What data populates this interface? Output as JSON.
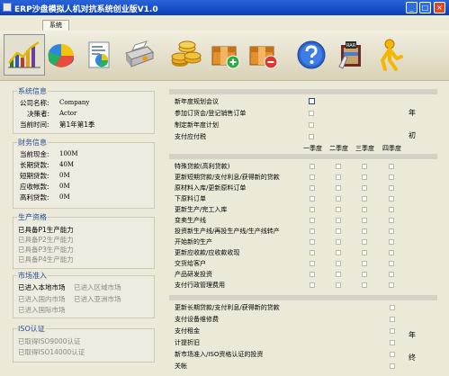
{
  "window": {
    "title": "ERP沙盘模拟人机对抗系统创业版V1.0",
    "controls": {
      "min": "_",
      "max": "□",
      "close": "×"
    }
  },
  "tabs": [
    {
      "label": "系统"
    }
  ],
  "toolbar": {
    "buttons": [
      {
        "icon": "line-chart-icon"
      },
      {
        "icon": "pie-chart-icon"
      },
      {
        "icon": "report-document-icon"
      },
      {
        "icon": "printer-icon"
      },
      {
        "icon": "coins-icon"
      },
      {
        "icon": "add-box-icon"
      },
      {
        "icon": "remove-box-icon"
      },
      {
        "icon": "help-icon"
      },
      {
        "icon": "winrar-icon"
      },
      {
        "icon": "aim-icon"
      }
    ]
  },
  "system_info": {
    "title": "系统信息",
    "company_label": "公司名称:",
    "company_value": "Company",
    "decision_label": "决策者:",
    "decision_value": "Actor",
    "time_label": "当前时间:",
    "time_value": "第1年第1季"
  },
  "finance_info": {
    "title": "财务信息",
    "items": [
      {
        "label": "当前现金:",
        "value": "100M"
      },
      {
        "label": "长期贷款:",
        "value": "40M"
      },
      {
        "label": "短期贷款:",
        "value": "0M"
      },
      {
        "label": "应收帐款:",
        "value": "0M"
      },
      {
        "label": "高利贷款:",
        "value": "0M"
      }
    ]
  },
  "production_qual": {
    "title": "生产资格",
    "items": [
      {
        "label": "已具备P1生产能力",
        "active": true
      },
      {
        "label": "已具备P2生产能力",
        "active": false
      },
      {
        "label": "已具备P3生产能力",
        "active": false
      },
      {
        "label": "已具备P4生产能力",
        "active": false
      }
    ]
  },
  "market_entry": {
    "title": "市场准入",
    "local": "已进入本地市场",
    "regional": "已进入区域市场",
    "domestic": "已进入国内市场",
    "asia": "已进入亚洲市场",
    "international": "已进入国际市场"
  },
  "iso": {
    "title": "ISO认证",
    "iso9000": "已取得ISO9000认证",
    "iso14000": "已取得ISO14000认证"
  },
  "year_start_tasks": [
    {
      "label": "新年度规划会议"
    },
    {
      "label": "参加订货会/登记销售订单"
    },
    {
      "label": "制定新年度计划"
    },
    {
      "label": "支付应付税"
    }
  ],
  "year_start_notes": {
    "year": "年",
    "init": "初"
  },
  "quarters": [
    "一季度",
    "二季度",
    "三季度",
    "四季度"
  ],
  "quarter_tasks": [
    {
      "label": "特殊贷款(高利贷款)"
    },
    {
      "label": "更新短期贷款/支付利息/获得新的贷款"
    },
    {
      "label": "原材料入库/更新原料订单"
    },
    {
      "label": "下原料订单"
    },
    {
      "label": "更新生产/完工入库"
    },
    {
      "label": "变卖生产线"
    },
    {
      "label": "投资新生产线/再投生产线/生产线转产"
    },
    {
      "label": "开始新的生产"
    },
    {
      "label": "更新应收款/应收款收现"
    },
    {
      "label": "交货给客户"
    },
    {
      "label": "产品研发投资"
    },
    {
      "label": "支付行政管理费用"
    }
  ],
  "year_end_tasks": [
    {
      "label": "更新长期贷款/支付利息/获得新的贷款"
    },
    {
      "label": "支付设备维修费"
    },
    {
      "label": "支付租金"
    },
    {
      "label": "计提折旧"
    },
    {
      "label": "新市场准入/ISO资格认证的投资"
    },
    {
      "label": "关帐"
    }
  ],
  "year_end_notes": {
    "year": "年",
    "end": "终"
  }
}
